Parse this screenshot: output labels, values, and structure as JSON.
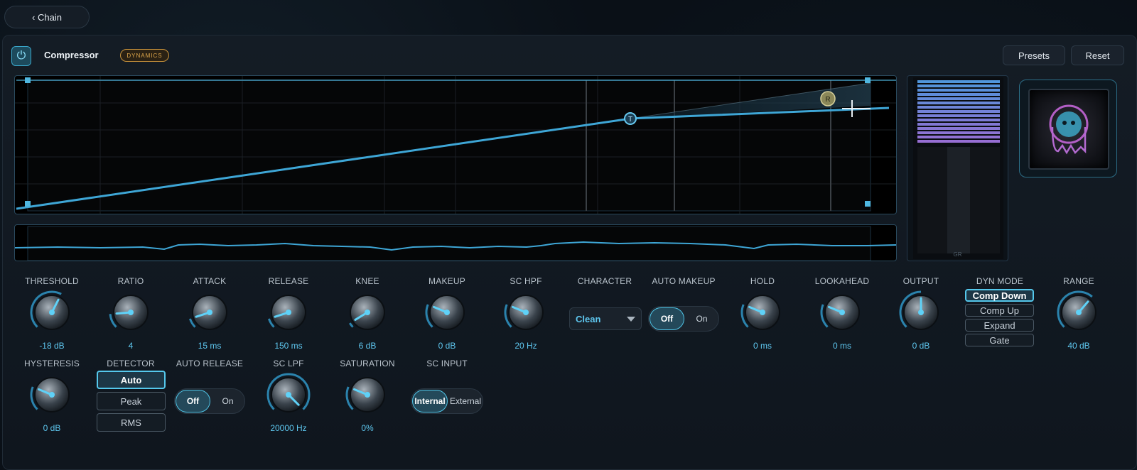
{
  "nav": {
    "back_label": "‹ Chain"
  },
  "header": {
    "title": "Compressor",
    "badge": "DYNAMICS",
    "presets_label": "Presets",
    "reset_label": "Reset"
  },
  "graph": {
    "threshold_marker": "T",
    "range_marker": "R"
  },
  "meter": {
    "label": "GR"
  },
  "colors": {
    "accent": "#4fc4e6",
    "badge": "#e0a84c",
    "value": "#5ec7ef"
  },
  "row1": [
    {
      "key": "threshold",
      "label": "THRESHOLD",
      "value": "-18 dB",
      "level": 0.6
    },
    {
      "key": "ratio",
      "label": "RATIO",
      "value": "4",
      "level": 0.15
    },
    {
      "key": "attack",
      "label": "ATTACK",
      "value": "15 ms",
      "level": 0.1
    },
    {
      "key": "release",
      "label": "RELEASE",
      "value": "150 ms",
      "level": 0.1
    },
    {
      "key": "knee",
      "label": "KNEE",
      "value": "6 dB",
      "level": 0.05
    },
    {
      "key": "makeup",
      "label": "MAKEUP",
      "value": "0 dB",
      "level": 0.25
    },
    {
      "key": "sc-hpf",
      "label": "SC HPF",
      "value": "20 Hz",
      "level": 0.25
    },
    {
      "key": "character",
      "label": "CHARACTER",
      "value": "Clean"
    },
    {
      "key": "auto-makeup",
      "label": "AUTO MAKEUP",
      "options": [
        "Off",
        "On"
      ],
      "selected": "Off"
    },
    {
      "key": "hold",
      "label": "HOLD",
      "value": "0 ms",
      "level": 0.25
    },
    {
      "key": "lookahead",
      "label": "LOOKAHEAD",
      "value": "0 ms",
      "level": 0.25
    },
    {
      "key": "output",
      "label": "OUTPUT",
      "value": "0 dB",
      "level": 0.5
    },
    {
      "key": "dyn-mode",
      "label": "DYN MODE",
      "options": [
        "Comp Down",
        "Comp Up",
        "Expand",
        "Gate"
      ],
      "selected": "Comp Down"
    },
    {
      "key": "range",
      "label": "RANGE",
      "value": "40 dB",
      "level": 0.65
    }
  ],
  "row2": [
    {
      "key": "hysteresis",
      "label": "HYSTERESIS",
      "value": "0 dB",
      "level": 0.25
    },
    {
      "key": "detector",
      "label": "DETECTOR",
      "options": [
        "Auto",
        "Peak",
        "RMS"
      ],
      "selected": "Auto"
    },
    {
      "key": "auto-release",
      "label": "AUTO RELEASE",
      "options": [
        "Off",
        "On"
      ],
      "selected": "Off"
    },
    {
      "key": "sc-lpf",
      "label": "SC LPF",
      "value": "20000 Hz",
      "level": 1.0
    },
    {
      "key": "saturation",
      "label": "SATURATION",
      "value": "0%",
      "level": 0.25
    },
    {
      "key": "sc-input",
      "label": "SC INPUT",
      "options": [
        "Internal",
        "External"
      ],
      "selected": "Internal"
    }
  ]
}
